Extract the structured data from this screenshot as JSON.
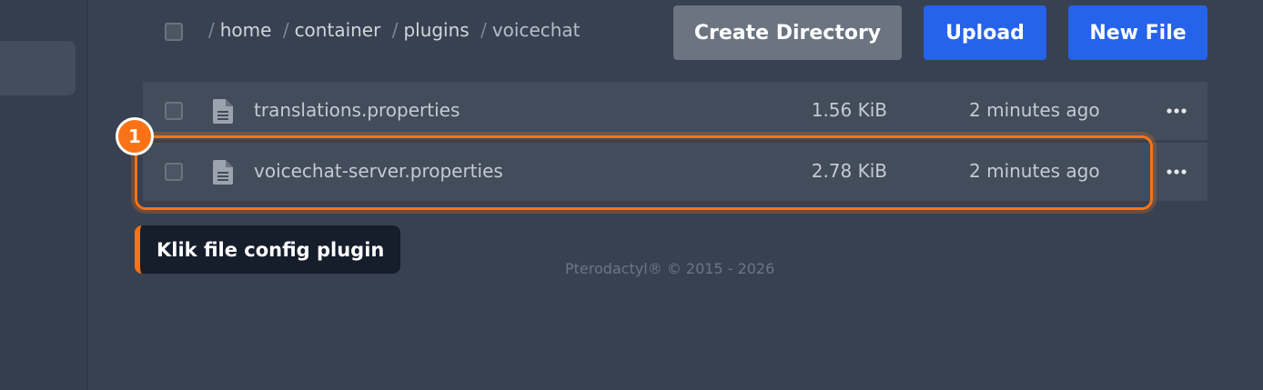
{
  "breadcrumb": {
    "separator": "/",
    "items": [
      "home",
      "container",
      "plugins",
      "voicechat"
    ]
  },
  "toolbar": {
    "create_directory_label": "Create Directory",
    "upload_label": "Upload",
    "new_file_label": "New File"
  },
  "files": [
    {
      "name": "translations.properties",
      "size": "1.56 KiB",
      "modified": "2 minutes ago",
      "icon": "file-text-icon"
    },
    {
      "name": "voicechat-server.properties",
      "size": "2.78 KiB",
      "modified": "2 minutes ago",
      "icon": "file-text-icon"
    }
  ],
  "annotation": {
    "step_number": "1",
    "tooltip_text": "Klik file config plugin",
    "accent_color": "#f97316"
  },
  "footer": {
    "text": "Pterodactyl® © 2015 - 2026"
  },
  "colors": {
    "background": "#374151",
    "row": "#424c5a",
    "primary_button": "#2563eb",
    "secondary_button": "#6b7480"
  }
}
